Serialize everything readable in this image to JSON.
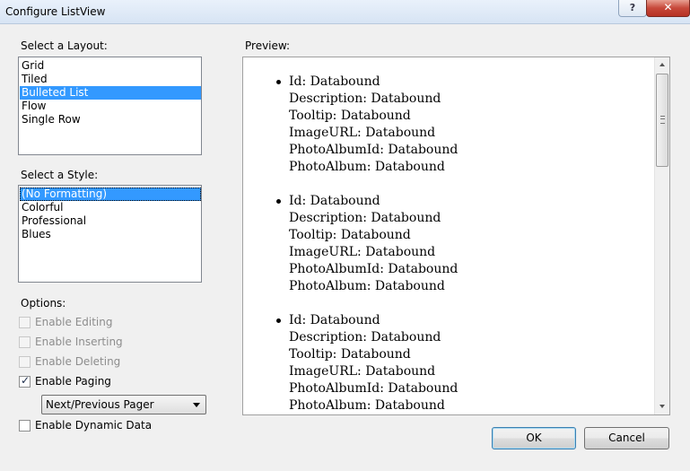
{
  "window": {
    "title": "Configure ListView",
    "help_label": "?",
    "close_label": "✕"
  },
  "layout": {
    "label": "Select a Layout:",
    "items": [
      "Grid",
      "Tiled",
      "Bulleted List",
      "Flow",
      "Single Row"
    ],
    "selected": "Bulleted List"
  },
  "style": {
    "label": "Select a Style:",
    "items": [
      "(No Formatting)",
      "Colorful",
      "Professional",
      "Blues"
    ],
    "selected": "(No Formatting)"
  },
  "options": {
    "label": "Options:",
    "enable_editing": {
      "label": "Enable Editing",
      "checked": false,
      "enabled": false
    },
    "enable_inserting": {
      "label": "Enable Inserting",
      "checked": false,
      "enabled": false
    },
    "enable_deleting": {
      "label": "Enable Deleting",
      "checked": false,
      "enabled": false
    },
    "enable_paging": {
      "label": "Enable Paging",
      "checked": true,
      "enabled": true
    },
    "pager": {
      "selected": "Next/Previous Pager"
    },
    "enable_dynamic_data": {
      "label": "Enable Dynamic Data",
      "checked": false,
      "enabled": true
    }
  },
  "preview": {
    "label": "Preview:",
    "records": [
      [
        "Id: Databound",
        "Description: Databound",
        "Tooltip: Databound",
        "ImageURL: Databound",
        "PhotoAlbumId: Databound",
        "PhotoAlbum: Databound"
      ],
      [
        "Id: Databound",
        "Description: Databound",
        "Tooltip: Databound",
        "ImageURL: Databound",
        "PhotoAlbumId: Databound",
        "PhotoAlbum: Databound"
      ],
      [
        "Id: Databound",
        "Description: Databound",
        "Tooltip: Databound",
        "ImageURL: Databound",
        "PhotoAlbumId: Databound",
        "PhotoAlbum: Databound"
      ]
    ]
  },
  "buttons": {
    "ok": "OK",
    "cancel": "Cancel"
  }
}
